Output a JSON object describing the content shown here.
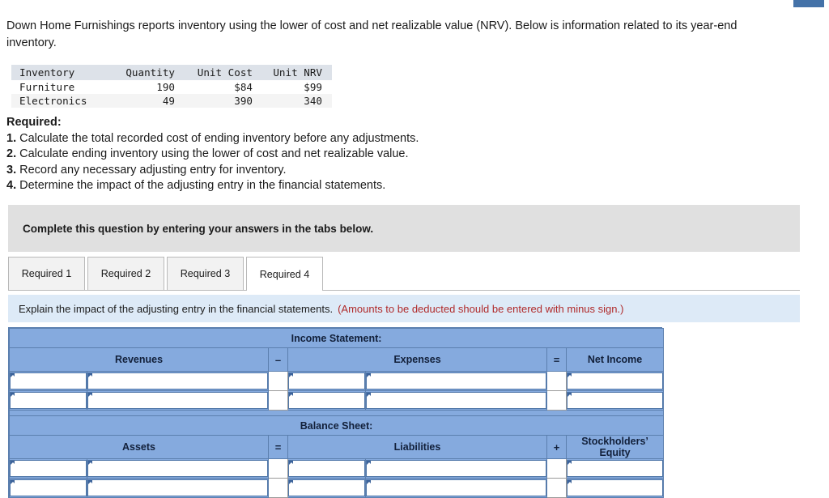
{
  "intro": {
    "text": "Down Home Furnishings reports inventory using the lower of cost and net realizable value (NRV). Below is information related to its year-end inventory."
  },
  "inventory_table": {
    "columns": [
      "Inventory",
      "Quantity",
      "Unit Cost",
      "Unit NRV"
    ],
    "rows": [
      {
        "inventory": "Furniture",
        "quantity": "190",
        "unit_cost": "$84",
        "unit_nrv": "$99"
      },
      {
        "inventory": "Electronics",
        "quantity": "49",
        "unit_cost": "390",
        "unit_nrv": "340"
      }
    ]
  },
  "required": {
    "heading": "Required:",
    "items": [
      {
        "num": "1.",
        "text": "Calculate the total recorded cost of ending inventory before any adjustments."
      },
      {
        "num": "2.",
        "text": "Calculate ending inventory using the lower of cost and net realizable value."
      },
      {
        "num": "3.",
        "text": "Record any necessary adjusting entry for inventory."
      },
      {
        "num": "4.",
        "text": "Determine the impact of the adjusting entry in the financial statements."
      }
    ]
  },
  "gray_banner": {
    "text": "Complete this question by entering your answers in the tabs below."
  },
  "tabs": [
    {
      "label": "Required 1",
      "active": false
    },
    {
      "label": "Required 2",
      "active": false
    },
    {
      "label": "Required 3",
      "active": false
    },
    {
      "label": "Required 4",
      "active": true
    }
  ],
  "blue_banner": {
    "text": "Explain the impact of the adjusting entry in the financial statements.",
    "note": "(Amounts to be deducted should be entered with minus sign.)",
    "note_color": "#b02a2a"
  },
  "answer_grid": {
    "income_statement": {
      "title": "Income Statement:",
      "col_revenues": "Revenues",
      "op_minus": "–",
      "col_expenses": "Expenses",
      "op_equals": "=",
      "col_net_income": "Net Income",
      "row_count": 2
    },
    "balance_sheet": {
      "title": "Balance Sheet:",
      "col_assets": "Assets",
      "op_equals": "=",
      "col_liabilities": "Liabilities",
      "op_plus": "+",
      "col_equity": "Stockholders’ Equity",
      "col_equity_line1": "Stockholders’",
      "col_equity_line2": "Equity",
      "row_count": 2
    }
  },
  "colors": {
    "header_blue": "#85aade",
    "header_border": "#5b7fae",
    "banner_gray": "#e0e0e0",
    "banner_blue": "#ddeaf7",
    "accent_marker": "#4472a8"
  }
}
